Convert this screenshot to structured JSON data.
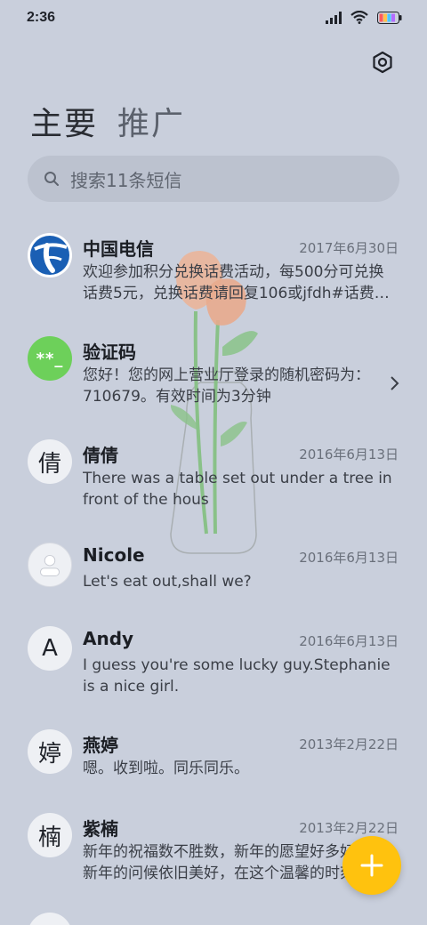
{
  "status": {
    "time": "2:36",
    "icons": [
      "signal-icon",
      "wifi-icon",
      "battery-icon"
    ]
  },
  "settings_icon": "settings-icon",
  "tabs": [
    {
      "label": "主要",
      "active": true
    },
    {
      "label": "推广",
      "active": false
    }
  ],
  "search": {
    "placeholder": "搜索11条短信"
  },
  "conversations": [
    {
      "name": "中国电信",
      "date": "2017年6月30日",
      "preview": "欢迎参加积分兑换话费活动，每500分可兑换话费5元，兑换话费请回复106或jfdh#话费…",
      "avatar": "telecom-logo"
    },
    {
      "name": "验证码",
      "date": "",
      "preview": "您好！您的网上营业厅登录的随机密码为：710679。有效时间为3分钟",
      "avatar_text": "**_"
    },
    {
      "name": "倩倩",
      "date": "2016年6月13日",
      "preview": "There was a table set out under a tree in front of the hous",
      "avatar_text": "倩"
    },
    {
      "name": "Nicole",
      "date": "2016年6月13日",
      "preview": "Let's eat out,shall we?",
      "avatar": "person-icon"
    },
    {
      "name": "Andy",
      "date": "2016年6月13日",
      "preview": "I guess you're some lucky guy.Stephanie is a nice girl.",
      "avatar_text": "A"
    },
    {
      "name": "燕婷",
      "date": "2013年2月22日",
      "preview": "嗯。收到啦。同乐同乐。",
      "avatar_text": "婷"
    },
    {
      "name": "紫楠",
      "date": "2013年2月22日",
      "preview": "新年的祝福数不胜数，新年的愿望好多好多，新年的问候依旧美好，在这个温馨的时刻…",
      "avatar_text": "楠"
    }
  ],
  "fab_icon": "plus-icon",
  "colors": {
    "background": "#c9cfdc",
    "fab": "#ffc20e",
    "green_avatar": "#6dd05a",
    "telecom_blue": "#1a5fb4"
  }
}
